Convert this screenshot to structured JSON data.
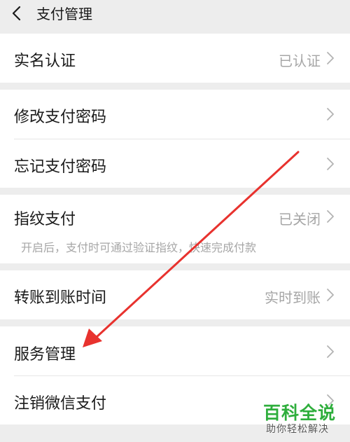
{
  "header": {
    "title": "支付管理"
  },
  "rows": {
    "real_name": {
      "label": "实名认证",
      "value": "已认证"
    },
    "change_password": {
      "label": "修改支付密码"
    },
    "forgot_password": {
      "label": "忘记支付密码"
    },
    "fingerprint": {
      "label": "指纹支付",
      "value": "已关闭",
      "hint": "开启后，支付时可通过验证指纹，快速完成付款"
    },
    "transfer_time": {
      "label": "转账到账时间",
      "value": "实时到账"
    },
    "service_management": {
      "label": "服务管理"
    },
    "deactivate": {
      "label": "注销微信支付"
    }
  },
  "watermark": {
    "main": "百科全说",
    "sub": "助你轻松解决"
  },
  "colors": {
    "background": "#ededed",
    "card": "#ffffff",
    "text": "#1a1a1a",
    "secondary_text": "#a6a6a6",
    "arrow": "#e8322e",
    "watermark": "#2eae3c"
  },
  "icons": {
    "back": "back-chevron-icon",
    "row_chevron": "chevron-right-icon"
  }
}
